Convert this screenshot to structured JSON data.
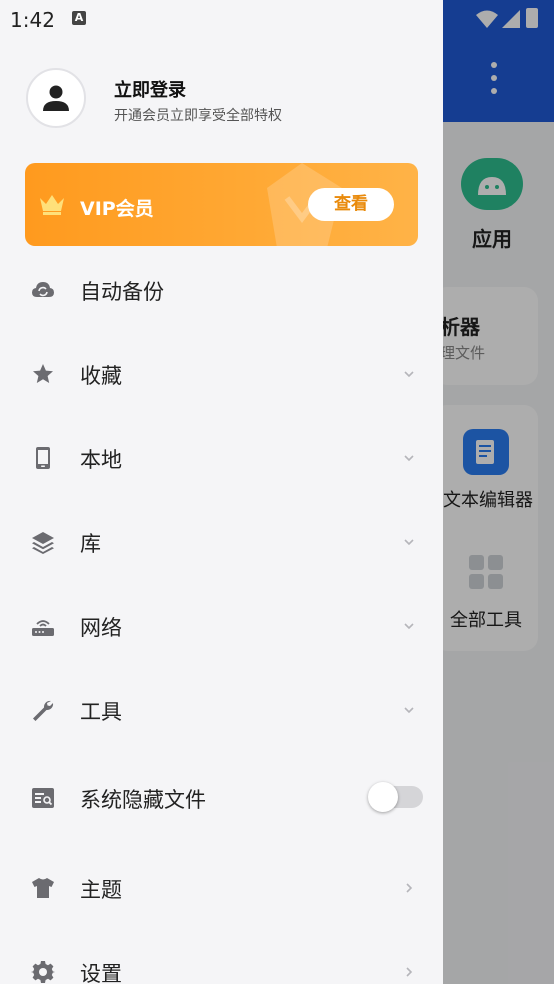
{
  "status_bar": {
    "time": "1:42",
    "notification_icon": "A"
  },
  "background_app": {
    "apps_label": "应用",
    "card1_title": "析器",
    "card1_sub": "理文件",
    "editor_label": "文本编辑器",
    "all_tools_label": "全部工具"
  },
  "drawer": {
    "login_title": "立即登录",
    "login_subtitle": "开通会员立即享受全部特权",
    "vip_label": "VIP会员",
    "vip_button": "查看",
    "menu": {
      "auto_backup": "自动备份",
      "favorites": "收藏",
      "local": "本地",
      "library": "库",
      "network": "网络",
      "tools": "工具",
      "hidden_files": "系统隐藏文件",
      "theme": "主题",
      "settings": "设置"
    },
    "hidden_files_toggle": false
  },
  "colors": {
    "vip_orange": "#ff9a1e",
    "icon_gray": "#6b6b70",
    "top_bar_blue": "#1f5bd6"
  },
  "icons": [
    "person-icon",
    "crown-icon",
    "cloud-sync-icon",
    "star-icon",
    "phone-icon",
    "layers-icon",
    "router-icon",
    "wrench-icon",
    "hidden-file-icon",
    "tshirt-icon",
    "gear-icon",
    "chevron-down-icon",
    "chevron-right-icon"
  ]
}
